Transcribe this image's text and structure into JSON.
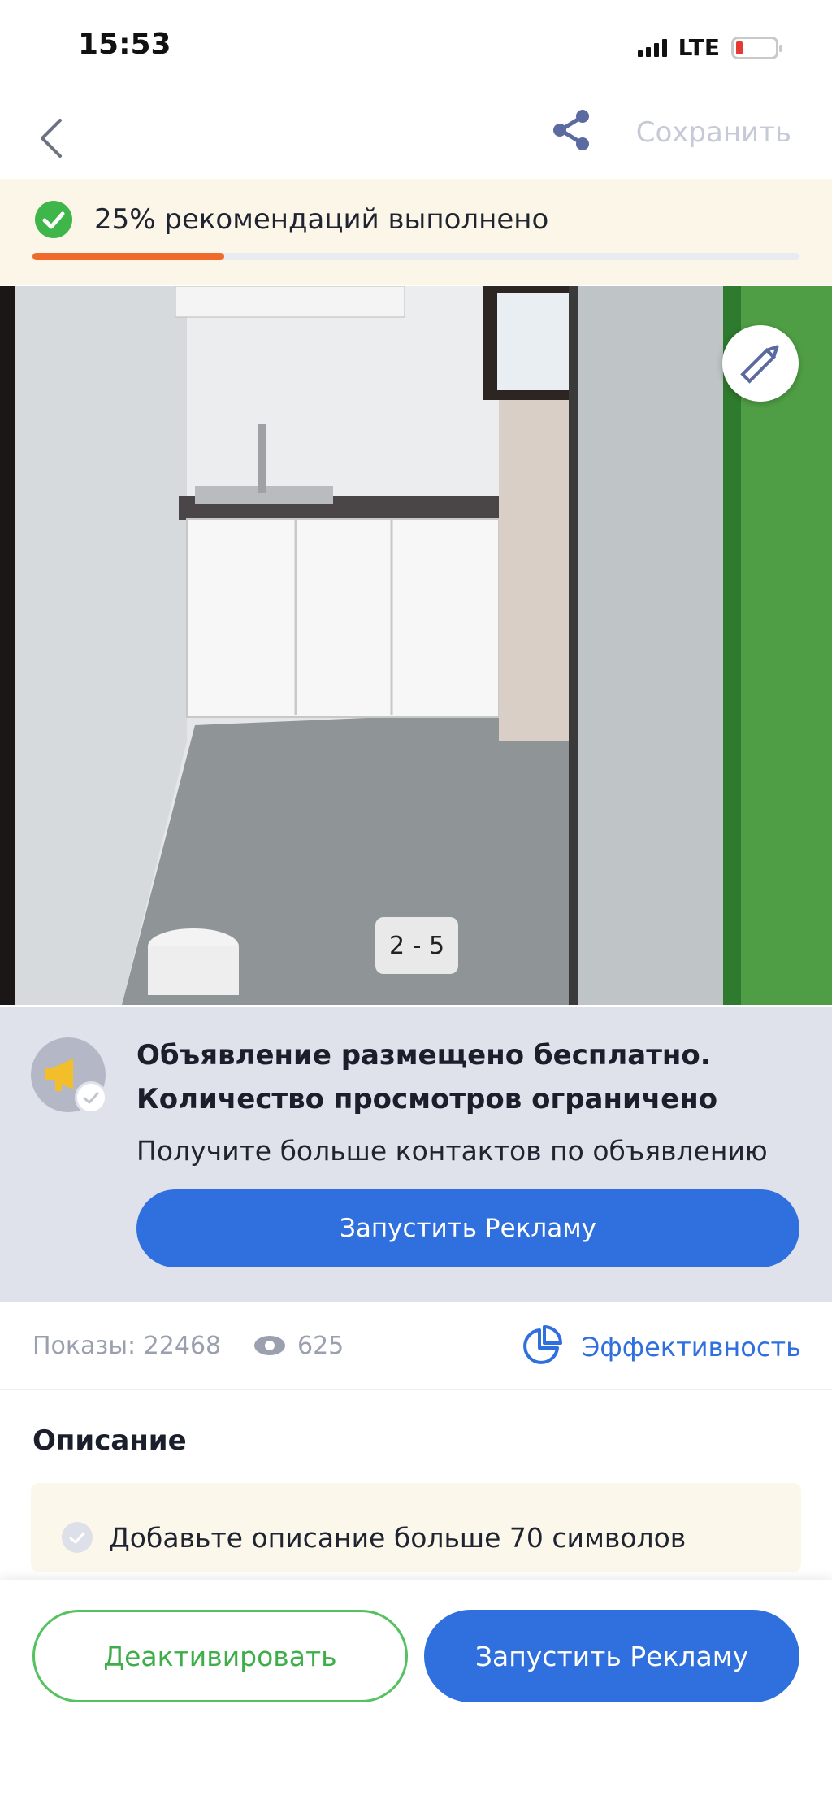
{
  "status_bar": {
    "time": "15:53",
    "network": "LTE"
  },
  "nav": {
    "save_label": "Сохранить",
    "icons": [
      "back-chevron-icon",
      "share-icon"
    ]
  },
  "progress": {
    "text": "25% рекомендаций выполнено",
    "percent": 25,
    "accent": "#ef6a2b",
    "check_color": "#3fb64a"
  },
  "photo": {
    "counter": "2 - 5",
    "icons": [
      "pencil-icon"
    ]
  },
  "promo": {
    "title_line1": "Объявление размещено бесплатно.",
    "title_line2": "Количество просмотров ограничено",
    "subtitle": "Получите больше контактов по объявлению",
    "button_label": "Запустить Рекламу",
    "icons": [
      "megaphone-icon",
      "check-icon"
    ]
  },
  "stats": {
    "impressions_label": "Показы: 22468",
    "views": "625",
    "efficiency_label": "Эффективность"
  },
  "description": {
    "title": "Описание",
    "hint": "Добавьте описание больше 70 символов"
  },
  "actions": {
    "deactivate_label": "Деактивировать",
    "run_ad_label": "Запустить Рекламу"
  },
  "colors": {
    "primary": "#2f6fde",
    "success": "#3fae4a",
    "muted": "#9aa0ad",
    "promo_bg": "#dfe2eb"
  }
}
